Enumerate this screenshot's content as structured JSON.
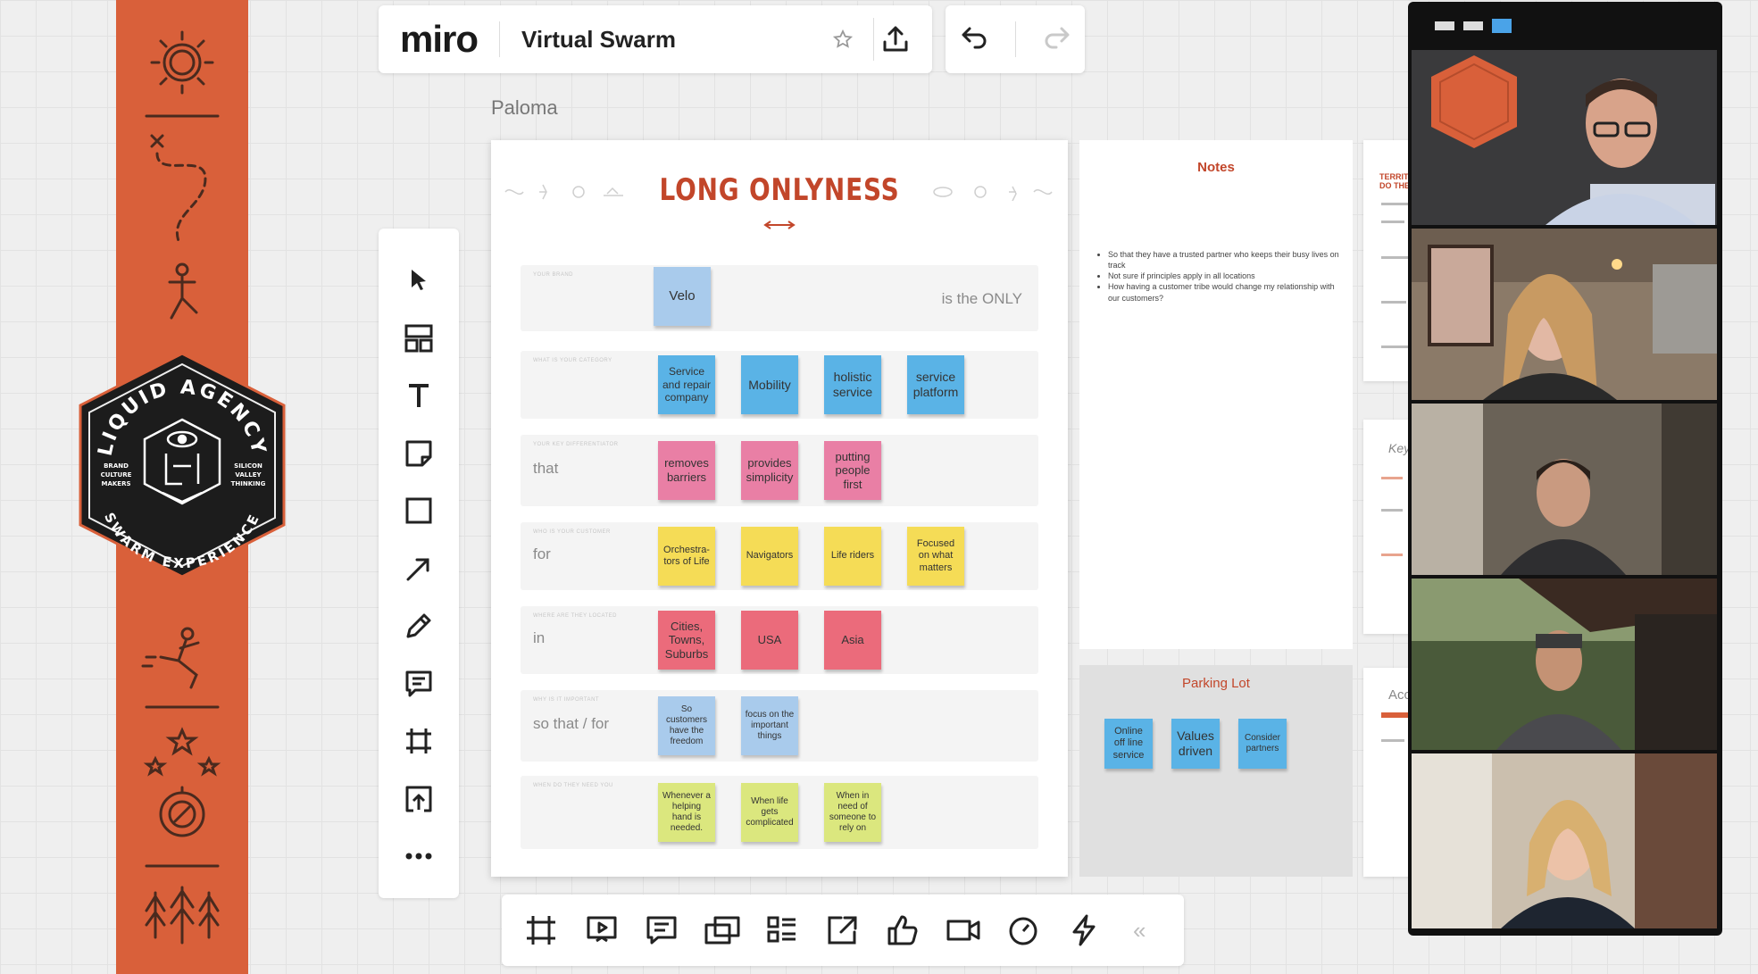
{
  "topbar": {
    "logo": "miro",
    "board_title": "Virtual Swarm",
    "star_icon": "star-icon",
    "share_icon": "upload-icon",
    "undo_icon": "undo-icon",
    "redo_icon": "redo-icon"
  },
  "cursor_label": "Paloma",
  "left_toolbar": [
    "select-icon",
    "templates-icon",
    "text-icon",
    "sticky-note-icon",
    "shape-icon",
    "connection-line-icon",
    "pen-icon",
    "comment-icon",
    "frame-icon",
    "upload-icon",
    "more-icon"
  ],
  "board": {
    "heading": "LONG ONLYNESS",
    "rows": [
      {
        "label": "",
        "tail": "is the ONLY",
        "stickies": [
          {
            "text": "Velo",
            "color": "#a9cbec"
          }
        ]
      },
      {
        "label": "",
        "tail": "",
        "stickies": [
          {
            "text": "Service and repair company",
            "color": "#5ab3e6"
          },
          {
            "text": "Mobility",
            "color": "#5ab3e6"
          },
          {
            "text": "holistic service",
            "color": "#5ab3e6"
          },
          {
            "text": "service platform",
            "color": "#5ab3e6"
          }
        ]
      },
      {
        "label": "that",
        "tail": "",
        "stickies": [
          {
            "text": "removes barriers",
            "color": "#e97fa5"
          },
          {
            "text": "provides simplicity",
            "color": "#e97fa5"
          },
          {
            "text": "putting people first",
            "color": "#e97fa5"
          }
        ]
      },
      {
        "label": "for",
        "tail": "",
        "stickies": [
          {
            "text": "Orchestra-tors of Life",
            "color": "#f5dc56"
          },
          {
            "text": "Navigators",
            "color": "#f5dc56"
          },
          {
            "text": "Life riders",
            "color": "#f5dc56"
          },
          {
            "text": "Focused on what matters",
            "color": "#f5dc56"
          }
        ]
      },
      {
        "label": "in",
        "tail": "",
        "stickies": [
          {
            "text": "Cities, Towns, Suburbs",
            "color": "#eb6b7b"
          },
          {
            "text": "USA",
            "color": "#eb6b7b"
          },
          {
            "text": "Asia",
            "color": "#eb6b7b"
          }
        ]
      },
      {
        "label": "so that / for",
        "tail": "",
        "stickies": [
          {
            "text": "So customers have the freedom",
            "color": "#a9cbec"
          },
          {
            "text": "focus on the important things",
            "color": "#a9cbec"
          }
        ]
      },
      {
        "label": "",
        "tail": "",
        "stickies": [
          {
            "text": "Whenever a helping hand is needed.",
            "color": "#dbe77e"
          },
          {
            "text": "When life gets complicated",
            "color": "#dbe77e"
          },
          {
            "text": "When in need of someone to rely on",
            "color": "#dbe77e"
          }
        ]
      }
    ]
  },
  "notes": {
    "title": "Notes",
    "items": [
      "So that they have a trusted partner who keeps their busy lives on track",
      "Not sure if principles apply in all locations",
      "How having a customer tribe would change my relationship with our customers?"
    ]
  },
  "parking_lot": {
    "title": "Parking Lot",
    "stickies": [
      {
        "text": "Online off line service",
        "color": "#5ab3e6"
      },
      {
        "text": "Values driven",
        "color": "#5ab3e6"
      },
      {
        "text": "Consider partners",
        "color": "#5ab3e6"
      }
    ]
  },
  "side_frames": [
    {
      "title": "TERRITO\nDO THE"
    },
    {
      "title": "Key"
    },
    {
      "title": "Acc"
    }
  ],
  "video_call": {
    "participants": 5,
    "view_mode_icon": "gallery-view-icon"
  },
  "bottom_toolbar": [
    "frames-icon",
    "presentation-icon",
    "comments-icon",
    "screen-share-icon",
    "card-icon",
    "export-icon",
    "vote-icon",
    "video-call-icon",
    "timer-icon",
    "lightning-icon"
  ],
  "collapse_label": "«",
  "brand": {
    "badge_top": "LIQUID AGENCY",
    "badge_bottom": "SWARM EXPERIENCE",
    "badge_left": [
      "BRAND",
      "CULTURE",
      "MAKERS"
    ],
    "badge_right": [
      "SILICON",
      "VALLEY",
      "THINKING"
    ],
    "accent": "#d9603a",
    "heading_color": "#c2462a"
  }
}
